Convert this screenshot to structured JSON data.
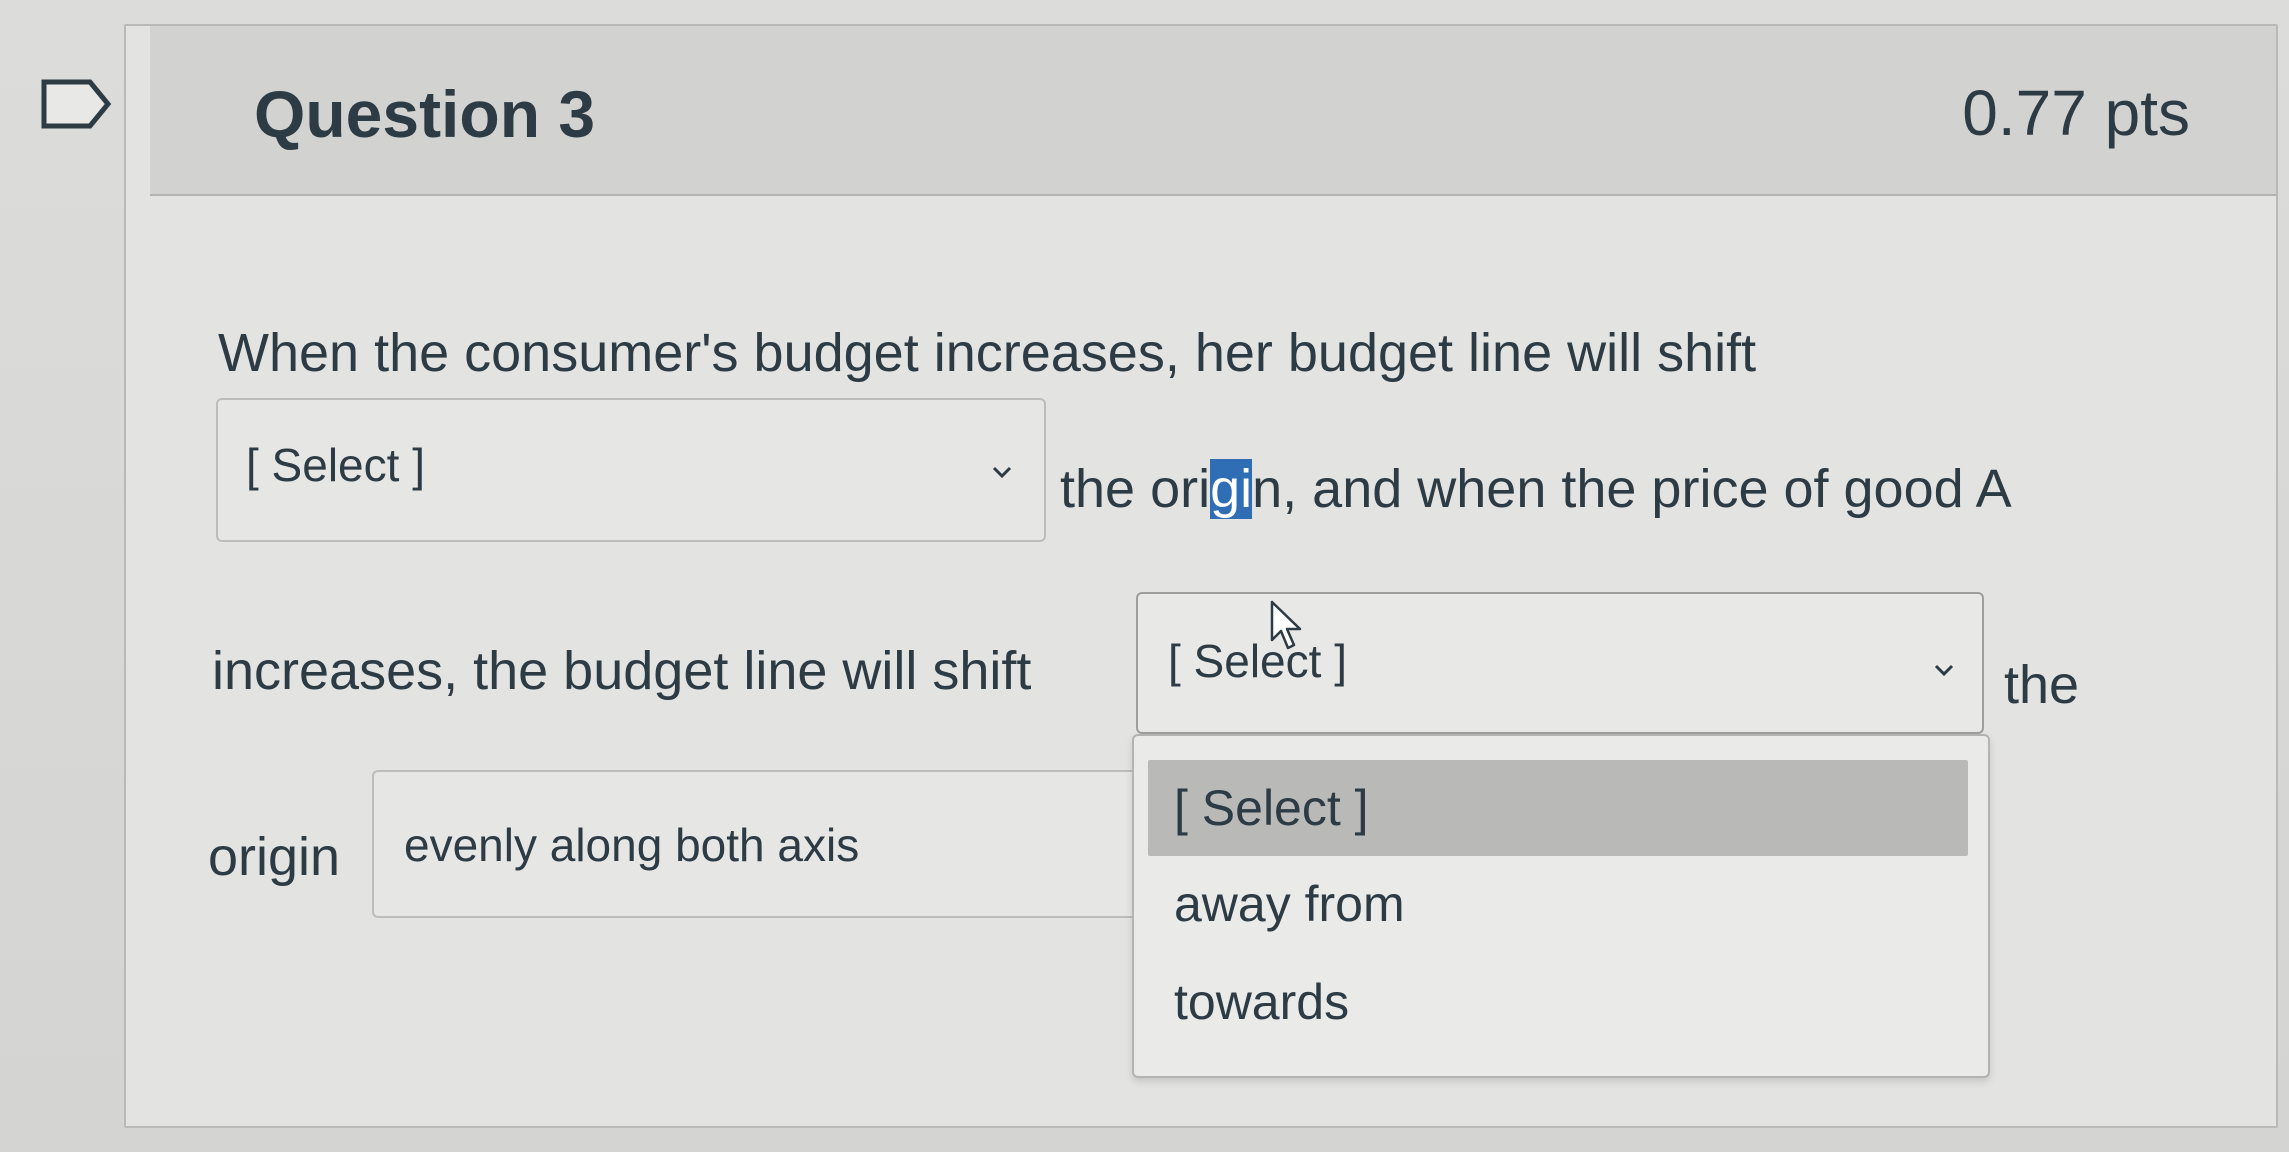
{
  "question": {
    "title": "Question 3",
    "points": "0.77 pts"
  },
  "body": {
    "line1": "When the consumer's budget increases, her budget line will shift",
    "after_select1_a": "the ori",
    "after_select1_highlight": "gi",
    "after_select1_b": "n, and when the price of  good A",
    "line3": "increases, the budget line will shift",
    "after_select2": "the",
    "line4_prefix": "origin"
  },
  "select1": {
    "value": "[ Select ]"
  },
  "select2": {
    "value": "[ Select ]"
  },
  "select3": {
    "value": "evenly along both axis"
  },
  "dropdown": {
    "options": [
      "[ Select ]",
      "away from",
      "towards"
    ],
    "selected_index": 0
  },
  "colors": {
    "text": "#2d3b45",
    "highlight": "#2f6db5",
    "selected_option_bg": "#b9b9b7"
  },
  "icons": [
    "bookmark-flag-icon",
    "chevron-down-icon",
    "mouse-cursor-icon"
  ]
}
